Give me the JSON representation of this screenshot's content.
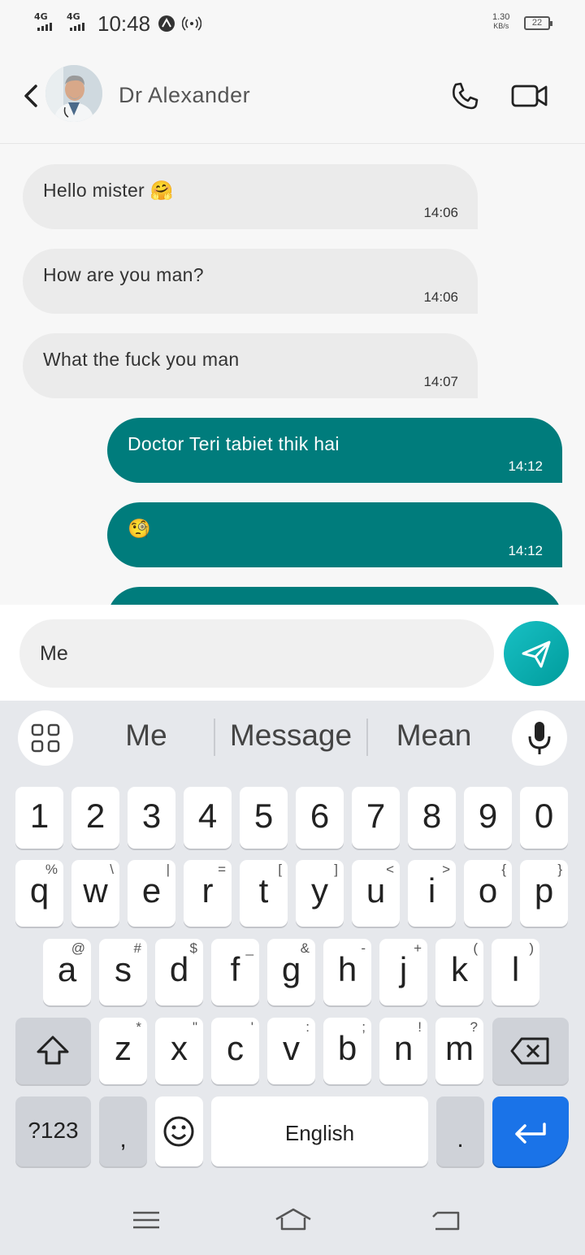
{
  "status_bar": {
    "sim1": "4G",
    "sim2": "4G",
    "time": "10:48",
    "speed_value": "1.30",
    "speed_unit": "KB/s",
    "battery": "22"
  },
  "header": {
    "contact_name": "Dr Alexander"
  },
  "messages": [
    {
      "dir": "in",
      "text": "Hello mister 🤗",
      "time": "14:06"
    },
    {
      "dir": "in",
      "text": "How are you man?",
      "time": "14:06"
    },
    {
      "dir": "in",
      "text": "What the fuck you man",
      "time": "14:07"
    },
    {
      "dir": "out",
      "text": "Doctor Teri tabiet thik hai",
      "time": "14:12"
    },
    {
      "dir": "out",
      "text": "🧐",
      "time": "14:12"
    },
    {
      "dir": "out",
      "text": "",
      "time": ""
    }
  ],
  "composer": {
    "input_value": "Me"
  },
  "keyboard": {
    "suggestions": [
      "Me",
      "Message",
      "Mean"
    ],
    "number_row": [
      "1",
      "2",
      "3",
      "4",
      "5",
      "6",
      "7",
      "8",
      "9",
      "0"
    ],
    "row1": [
      {
        "key": "q",
        "hint": "%"
      },
      {
        "key": "w",
        "hint": "\\"
      },
      {
        "key": "e",
        "hint": "|"
      },
      {
        "key": "r",
        "hint": "="
      },
      {
        "key": "t",
        "hint": "["
      },
      {
        "key": "y",
        "hint": "]"
      },
      {
        "key": "u",
        "hint": "<"
      },
      {
        "key": "i",
        "hint": ">"
      },
      {
        "key": "o",
        "hint": "{"
      },
      {
        "key": "p",
        "hint": "}"
      }
    ],
    "row2": [
      {
        "key": "a",
        "hint": "@"
      },
      {
        "key": "s",
        "hint": "#"
      },
      {
        "key": "d",
        "hint": "$"
      },
      {
        "key": "f",
        "hint": "_"
      },
      {
        "key": "g",
        "hint": "&"
      },
      {
        "key": "h",
        "hint": "-"
      },
      {
        "key": "j",
        "hint": "+"
      },
      {
        "key": "k",
        "hint": "("
      },
      {
        "key": "l",
        "hint": ")"
      }
    ],
    "row3": [
      {
        "key": "z",
        "hint": "*"
      },
      {
        "key": "x",
        "hint": "\""
      },
      {
        "key": "c",
        "hint": "'"
      },
      {
        "key": "v",
        "hint": ":"
      },
      {
        "key": "b",
        "hint": ";"
      },
      {
        "key": "n",
        "hint": "!"
      },
      {
        "key": "m",
        "hint": "?"
      }
    ],
    "symbols_label": "?123",
    "comma_label": ",",
    "space_label": "English",
    "period_label": "."
  },
  "icons": {
    "back": "chevron-left-icon",
    "call": "phone-icon",
    "video": "video-camera-icon",
    "send": "paper-plane-icon",
    "mic": "microphone-icon",
    "menu": "grid-icon",
    "shift": "shift-arrow-icon",
    "backspace": "backspace-icon",
    "emoji": "smiley-icon",
    "enter": "enter-arrow-icon"
  },
  "colors": {
    "outgoing_bubble": "#007c7c",
    "incoming_bubble": "#ebebeb",
    "send_button": "#12b3b6",
    "enter_key": "#1a73e8"
  }
}
